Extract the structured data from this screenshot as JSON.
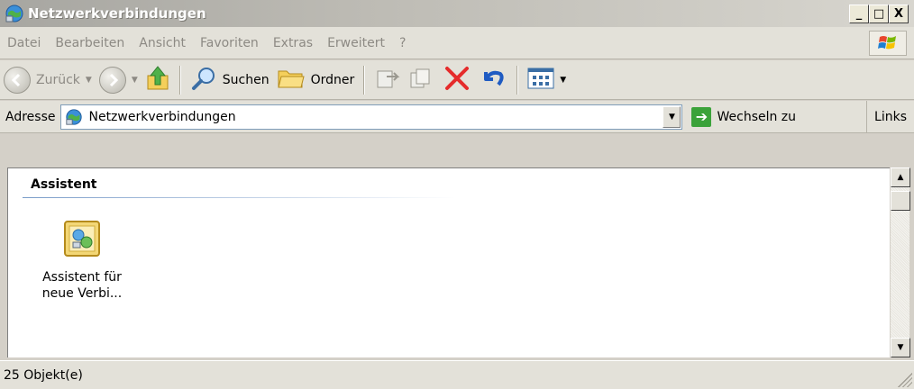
{
  "window": {
    "title": "Netzwerkverbindungen",
    "icon": "network-globe-icon",
    "buttons": {
      "minimize": "_",
      "maximize": "□",
      "close": "X"
    }
  },
  "menu": {
    "items": [
      "Datei",
      "Bearbeiten",
      "Ansicht",
      "Favoriten",
      "Extras",
      "Erweitert",
      "?"
    ]
  },
  "toolbar": {
    "back_label": "Zurück",
    "search_label": "Suchen",
    "folders_label": "Ordner"
  },
  "address": {
    "label": "Adresse",
    "value": "Netzwerkverbindungen",
    "go_label": "Wechseln zu",
    "links_label": "Links"
  },
  "content": {
    "group_header": "Assistent",
    "items": [
      {
        "label_line1": "Assistent für",
        "label_line2": "neue Verbi...",
        "icon": "wizard-icon"
      }
    ]
  },
  "status": {
    "text": "25 Objekt(e)"
  },
  "colors": {
    "accent_blue": "#3a6ea5",
    "go_green": "#3ba23a",
    "delete_red": "#e52b2b",
    "undo_blue": "#1f5bc2"
  }
}
